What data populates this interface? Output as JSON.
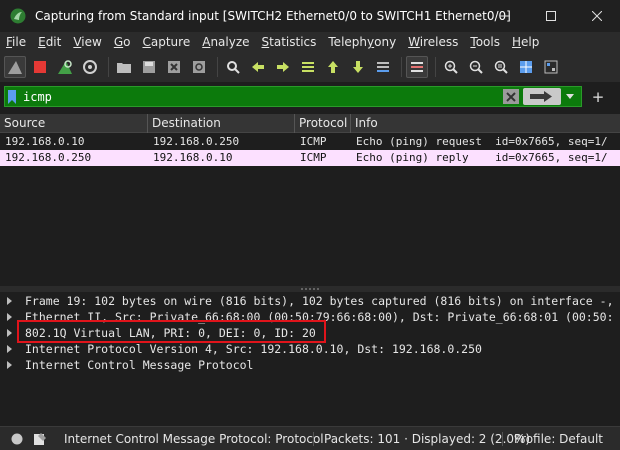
{
  "window": {
    "title": "Capturing from Standard input [SWITCH2 Ethernet0/0 to SWITCH1 Ethernet0/0]",
    "app_icon": "wireshark-fin-icon"
  },
  "menu": [
    {
      "label": "File",
      "ul": "F",
      "rest": "ile"
    },
    {
      "label": "Edit",
      "ul": "E",
      "rest": "dit"
    },
    {
      "label": "View",
      "ul": "V",
      "rest": "iew"
    },
    {
      "label": "Go",
      "ul": "G",
      "rest": "o"
    },
    {
      "label": "Capture",
      "ul": "C",
      "rest": "apture"
    },
    {
      "label": "Analyze",
      "ul": "A",
      "rest": "nalyze"
    },
    {
      "label": "Statistics",
      "ul": "S",
      "rest": "tatistics"
    },
    {
      "label": "Telephony",
      "ul": "y",
      "pre": "Teleph",
      "rest": "ony"
    },
    {
      "label": "Wireless",
      "ul": "W",
      "rest": "ireless"
    },
    {
      "label": "Tools",
      "ul": "T",
      "rest": "ools"
    },
    {
      "label": "Help",
      "ul": "H",
      "rest": "elp"
    }
  ],
  "filter": {
    "value": "icmp",
    "colors": {
      "valid_bg": "#0c7a0c"
    }
  },
  "packet_list": {
    "columns": [
      "Source",
      "Destination",
      "Protocol",
      "Info"
    ],
    "rows": [
      {
        "source": "192.168.0.10",
        "destination": "192.168.0.250",
        "protocol": "ICMP",
        "info": "Echo (ping) request  id=0x7665, seq=1/"
      },
      {
        "source": "192.168.0.250",
        "destination": "192.168.0.10",
        "protocol": "ICMP",
        "info": "Echo (ping) reply    id=0x7665, seq=1/"
      }
    ],
    "colors": {
      "icmp_row_bg": "#fce0ff"
    }
  },
  "details": [
    "Frame 19: 102 bytes on wire (816 bits), 102 bytes captured (816 bits) on interface -,",
    "Ethernet II, Src: Private_66:68:00 (00:50:79:66:68:00), Dst: Private_66:68:01 (00:50:",
    "802.1Q Virtual LAN, PRI: 0, DEI: 0, ID: 20",
    "Internet Protocol Version 4, Src: 192.168.0.10, Dst: 192.168.0.250",
    "Internet Control Message Protocol"
  ],
  "highlight": {
    "color": "#e0141b"
  },
  "status": {
    "field": "Internet Control Message Protocol: Protocol",
    "packets": "Packets: 101 · Displayed: 2 (2.0%)",
    "profile": "Profile: Default"
  }
}
